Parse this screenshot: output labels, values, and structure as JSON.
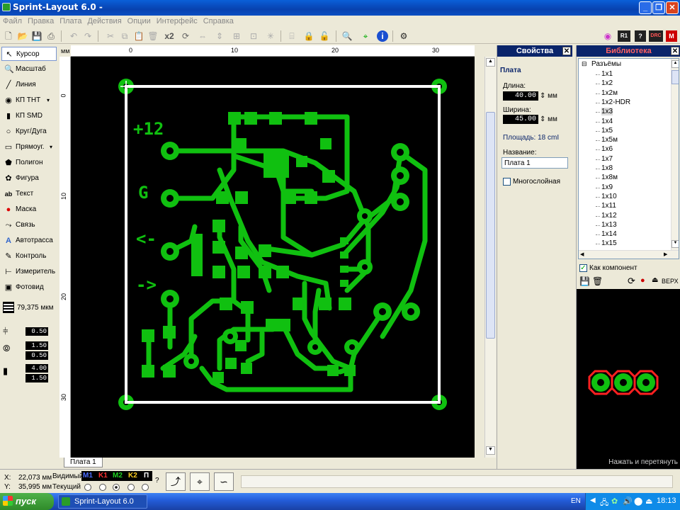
{
  "window": {
    "title": "Sprint-Layout 6.0 -"
  },
  "menu": [
    "Файл",
    "Правка",
    "Плата",
    "Действия",
    "Опции",
    "Интерфейс",
    "Справка"
  ],
  "toolbar": {
    "x2_label": "x2",
    "drc_label": "DRC",
    "r1_label": "R1"
  },
  "tools": [
    {
      "label": "Курсор",
      "icon": "cursor-icon"
    },
    {
      "label": "Масштаб",
      "icon": "zoom-icon"
    },
    {
      "label": "Линия",
      "icon": "line-icon"
    },
    {
      "label": "КП ТНТ",
      "icon": "tht-pad-icon"
    },
    {
      "label": "КП SMD",
      "icon": "smd-pad-icon"
    },
    {
      "label": "Круг/Дуга",
      "icon": "circle-icon"
    },
    {
      "label": "Прямоуг.",
      "icon": "rectangle-icon"
    },
    {
      "label": "Полигон",
      "icon": "polygon-icon"
    },
    {
      "label": "Фигура",
      "icon": "shape-icon"
    },
    {
      "label": "Текст",
      "icon": "text-icon"
    },
    {
      "label": "Маска",
      "icon": "mask-icon"
    },
    {
      "label": "Связь",
      "icon": "connection-icon"
    },
    {
      "label": "Автотрасса",
      "icon": "autoroute-icon"
    },
    {
      "label": "Контроль",
      "icon": "control-icon"
    },
    {
      "label": "Измеритель",
      "icon": "measure-icon"
    },
    {
      "label": "Фотовид",
      "icon": "photoview-icon"
    }
  ],
  "grid": {
    "value": "79,375 мкм"
  },
  "params": {
    "track_width": "0.50",
    "pad_outer": "1.50",
    "pad_inner": "0.50",
    "smd_w": "4.00",
    "smd_h": "1.50"
  },
  "ruler": {
    "unit": "мм",
    "top_ticks": [
      "0",
      "10",
      "20",
      "30"
    ],
    "left_ticks": [
      "0",
      "10",
      "20",
      "30"
    ]
  },
  "board_text": {
    "plus12": "+12",
    "g": "G",
    "left_arrow": "<-",
    "right_arrow": "->"
  },
  "sheet_tab": "Плата 1",
  "properties": {
    "title": "Свойства",
    "section": "Плата",
    "length_label": "Длина:",
    "length_value": "40.00",
    "length_unit": "мм",
    "width_label": "Ширина:",
    "width_value": "45.00",
    "width_unit": "мм",
    "area": "Площадь:   18 cmI",
    "name_label": "Название:",
    "name_value": "Плата 1",
    "multilayer_label": "Многослойная"
  },
  "library": {
    "title": "Библиотека",
    "root": "Разъёмы",
    "items": [
      "1x1",
      "1x2",
      "1x2м",
      "1x2-HDR",
      "1x3",
      "1x4",
      "1x5",
      "1x5м",
      "1x6",
      "1x7",
      "1x8",
      "1x8м",
      "1x9",
      "1x10",
      "1x11",
      "1x12",
      "1x13",
      "1x14",
      "1x15"
    ],
    "selected": "1x3",
    "as_component_label": "Как компонент",
    "side_label": "ВЕРХ",
    "drag_hint": "Нажать и перетянуть"
  },
  "status": {
    "x_label": "X:",
    "x_value": "22,073 мм",
    "y_label": "Y:",
    "y_value": "35,995 мм",
    "visible_label": "Видимый",
    "current_label": "Текущий",
    "layers": [
      {
        "name": "M1",
        "color": "#4a6cff"
      },
      {
        "name": "K1",
        "color": "#ff3030"
      },
      {
        "name": "M2",
        "color": "#20d020"
      },
      {
        "name": "K2",
        "color": "#ffd020"
      },
      {
        "name": "П",
        "color": "#ffffff"
      }
    ],
    "q": "?"
  },
  "taskbar": {
    "start": "пуск",
    "app": "Sprint-Layout 6.0",
    "lang": "EN",
    "time": "18:13"
  }
}
